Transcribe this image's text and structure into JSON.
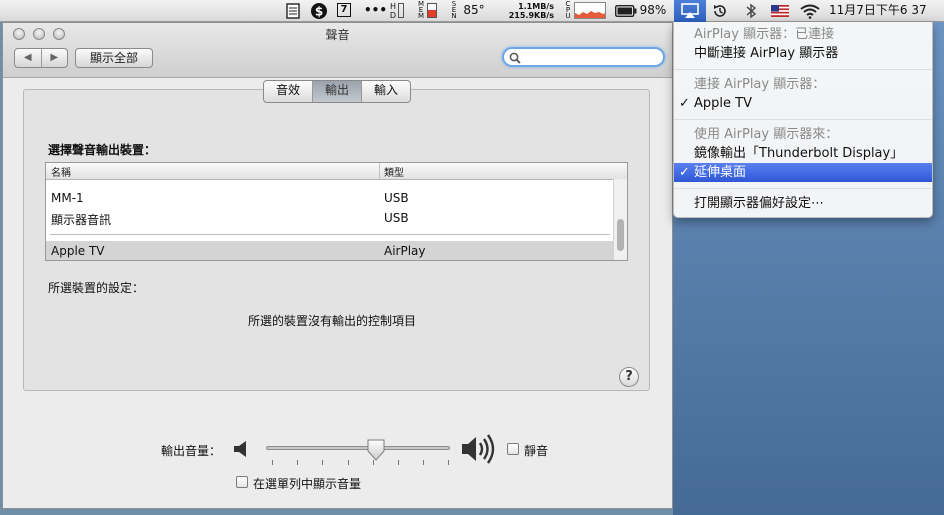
{
  "menubar": {
    "net_up": "1.1MB/s",
    "net_down": "215.9KB/s",
    "temp": "85°",
    "battery": "98%",
    "datetime": "11月7日下午6 37",
    "calendar_day": "7",
    "more": "•••",
    "cpu_label": "CPU",
    "hd_label": "HD",
    "mem_label": "MEM",
    "sen_label": "SEN"
  },
  "window": {
    "title": "聲音",
    "back": "◀",
    "forward": "▶",
    "show_all": "顯示全部",
    "search_placeholder": ""
  },
  "tabs": [
    "音效",
    "輸出",
    "輸入"
  ],
  "output": {
    "select_label": "選擇聲音輸出裝置：",
    "columns": [
      "名稱",
      "類型"
    ],
    "rows": [
      {
        "name": "MM-1",
        "type": "USB"
      },
      {
        "name": "顯示器音訊",
        "type": "USB"
      },
      {
        "name": "Apple TV",
        "type": "AirPlay"
      }
    ],
    "settings_label": "所選裝置的設定：",
    "no_controls": "所選的裝置沒有輸出的控制項目",
    "help": "?"
  },
  "volume": {
    "label": "輸出音量：",
    "level": 0.6,
    "mute_label": "靜音",
    "show_in_menubar": "在選單列中顯示音量"
  },
  "airplay_menu": {
    "status": "AirPlay 顯示器：已連接",
    "disconnect": "中斷連接 AirPlay 顯示器",
    "connect_header": "連接 AirPlay 顯示器：",
    "device": "Apple TV",
    "use_header": "使用 AirPlay 顯示器來：",
    "mirror": "鏡像輸出「Thunderbolt Display」",
    "extend": "延伸桌面",
    "open_prefs": "打開顯示器偏好設定⋯",
    "checkmark": "✓"
  },
  "colors": {
    "highlight": "#3a63e0",
    "focus_ring": "#6fa6e8"
  }
}
